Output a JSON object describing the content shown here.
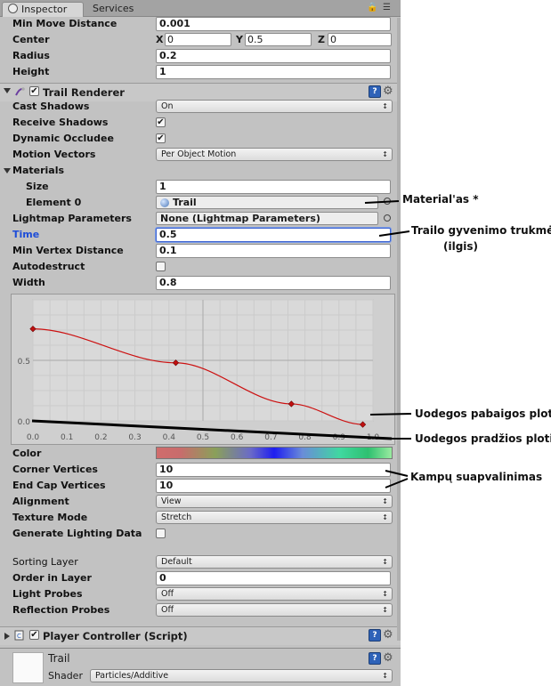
{
  "tabs": [
    {
      "label": "Inspector"
    },
    {
      "label": "Services"
    }
  ],
  "top_rows": {
    "min_move_distance": {
      "label": "Min Move Distance",
      "value": "0.001"
    },
    "center": {
      "label": "Center",
      "x_label": "X",
      "x": "0",
      "y_label": "Y",
      "y": "0.5",
      "z_label": "Z",
      "z": "0"
    },
    "radius": {
      "label": "Radius",
      "value": "0.2"
    },
    "height": {
      "label": "Height",
      "value": "1"
    }
  },
  "trail_renderer": {
    "title": "Trail Renderer",
    "cast_shadows": {
      "label": "Cast Shadows",
      "value": "On"
    },
    "receive_shadows": {
      "label": "Receive Shadows",
      "checked": "✔"
    },
    "dynamic_occludee": {
      "label": "Dynamic Occludee",
      "checked": "✔"
    },
    "motion_vectors": {
      "label": "Motion Vectors",
      "value": "Per Object Motion"
    },
    "materials": {
      "label": "Materials",
      "size_label": "Size",
      "size": "1",
      "element_label": "Element 0",
      "element_value": "Trail"
    },
    "lightmap_parameters": {
      "label": "Lightmap Parameters",
      "value": "None (Lightmap Parameters)"
    },
    "time": {
      "label": "Time",
      "value": "0.5"
    },
    "min_vertex_distance": {
      "label": "Min Vertex Distance",
      "value": "0.1"
    },
    "autodestruct": {
      "label": "Autodestruct",
      "checked": ""
    },
    "width": {
      "label": "Width",
      "value": "0.8"
    },
    "color": {
      "label": "Color"
    },
    "corner_vertices": {
      "label": "Corner Vertices",
      "value": "10"
    },
    "end_cap_vertices": {
      "label": "End Cap Vertices",
      "value": "10"
    },
    "alignment": {
      "label": "Alignment",
      "value": "View"
    },
    "texture_mode": {
      "label": "Texture Mode",
      "value": "Stretch"
    },
    "generate_lighting_data": {
      "label": "Generate Lighting Data",
      "checked": ""
    },
    "sorting_layer": {
      "label": "Sorting Layer",
      "value": "Default"
    },
    "order_in_layer": {
      "label": "Order in Layer",
      "value": "0"
    },
    "light_probes": {
      "label": "Light Probes",
      "value": "Off"
    },
    "reflection_probes": {
      "label": "Reflection Probes",
      "value": "Off"
    }
  },
  "chart_data": {
    "type": "line",
    "x_ticks": [
      "0.0",
      "0.1",
      "0.2",
      "0.3",
      "0.4",
      "0.5",
      "0.6",
      "0.7",
      "0.8",
      "0.9",
      "1.0"
    ],
    "y_ticks": [
      "0.0",
      "0.5"
    ],
    "xlim": [
      0,
      1
    ],
    "ylim": [
      0,
      1
    ],
    "keyframes": [
      {
        "x": 0.0,
        "y": 0.76
      },
      {
        "x": 0.42,
        "y": 0.48
      },
      {
        "x": 0.76,
        "y": 0.14
      },
      {
        "x": 0.97,
        "y": -0.03
      }
    ],
    "curve_color": "#cc1111"
  },
  "player_controller": {
    "title": "Player Controller (Script)"
  },
  "material_block": {
    "name": "Trail",
    "shader_label": "Shader",
    "shader_value": "Particles/Additive"
  },
  "annotations": {
    "material": "Material'as *",
    "time_1": "Trailo gyvenimo trukmė",
    "time_2": "(ilgis)",
    "tail_end": "Uodegos pabaigos plotis",
    "tail_start": "Uodegos pradžios plotis",
    "corners": "Kampų suapvalinimas"
  }
}
